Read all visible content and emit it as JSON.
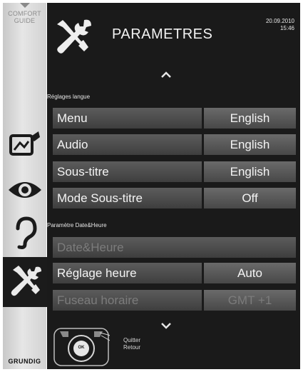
{
  "sidebar": {
    "comfort_guide": [
      "COMFORT",
      "GUIDE"
    ],
    "brand": "GRUNDIG"
  },
  "header": {
    "title": "PARAMETRES",
    "date": "20.09.2010",
    "time": "15:46"
  },
  "sections": {
    "language": "Réglages langue",
    "datetime": "Paramètre Date&Heure"
  },
  "language_rows": [
    {
      "label": "Menu",
      "value": "English"
    },
    {
      "label": "Audio",
      "value": "English"
    },
    {
      "label": "Sous-titre",
      "value": "English"
    },
    {
      "label": "Mode Sous-titre",
      "value": "Off"
    }
  ],
  "datetime_rows": [
    {
      "label": "Date&Heure"
    },
    {
      "label": "Réglage heure",
      "value": "Auto"
    },
    {
      "label": "Fuseau horaire",
      "value": "GMT +1"
    }
  ],
  "footer": {
    "quit": "Quitter",
    "back": "Retour",
    "ok": "OK"
  },
  "icons": {
    "up_arrow": "chevron-up-icon",
    "down_arrow": "chevron-down-icon",
    "header": "tools-icon"
  },
  "colors": {
    "panel_bg": "#1a1a1a",
    "row_bg": "#4a4a4a",
    "text": "#f4f4f4",
    "dim_text": "#7c7c7c"
  }
}
